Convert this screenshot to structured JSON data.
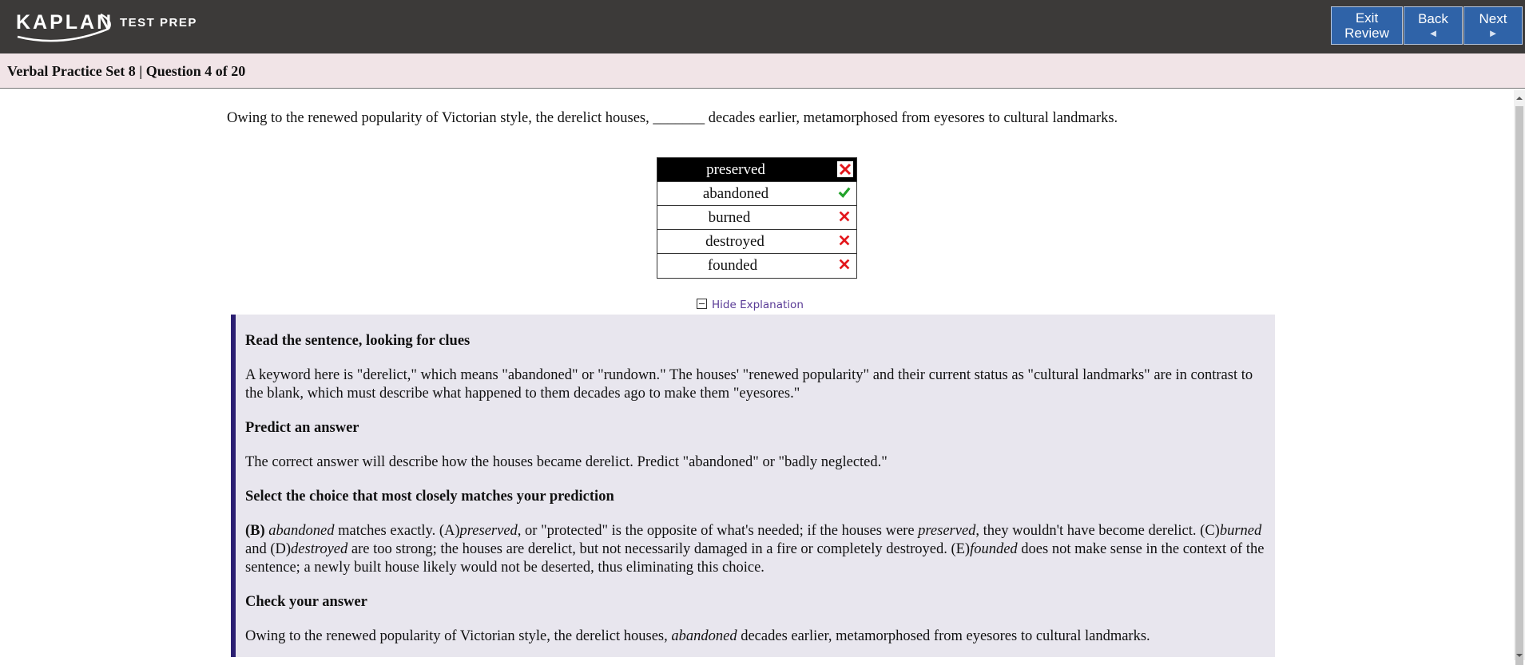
{
  "brand": {
    "name": "KAPLAN",
    "sub": "TEST PREP"
  },
  "nav": {
    "exit_line1": "Exit",
    "exit_line2": "Review",
    "back_label": "Back",
    "next_label": "Next"
  },
  "header": {
    "title": "Verbal Practice Set 8 | Question 4 of 20"
  },
  "question": {
    "text": "Owing to the renewed popularity of Victorian style, the derelict houses, _______ decades earlier, metamorphosed from eyesores to cultural landmarks."
  },
  "choices": [
    {
      "label": "preserved",
      "status": "incorrect",
      "selected": true
    },
    {
      "label": "abandoned",
      "status": "correct",
      "selected": false
    },
    {
      "label": "burned",
      "status": "incorrect",
      "selected": false
    },
    {
      "label": "destroyed",
      "status": "incorrect",
      "selected": false
    },
    {
      "label": "founded",
      "status": "incorrect",
      "selected": false
    }
  ],
  "explanation": {
    "toggle_label": "Hide Explanation",
    "h1": "Read the sentence, looking for clues",
    "p1": "A keyword here is \"derelict,\" which means \"abandoned\" or \"rundown.\" The houses' \"renewed popularity\" and their current status as \"cultural landmarks\" are in contrast to the blank, which must describe what happened to them decades ago to make them \"eyesores.\"",
    "h2": "Predict an answer",
    "p2": "The correct answer will describe how the houses became derelict. Predict \"abandoned\" or \"badly neglected.\"",
    "h3": "Select the choice that most closely matches your prediction",
    "p3": {
      "b": "(B)",
      "i1": "abandoned",
      "t1": " matches exactly. (A)",
      "i2": "preserved",
      "t2": ", or \"protected\" is the opposite of what's needed; if the houses were ",
      "i3": "preserved",
      "t3": ", they wouldn't have become derelict. (C)",
      "i4": "burned",
      "t4": " and (D)",
      "i5": "destroyed",
      "t5": " are too strong; the houses are derelict, but not necessarily damaged in a fire or completely destroyed. (E)",
      "i6": "founded",
      "t6": " does not make sense in the context of the sentence; a newly built house likely would not be deserted, thus eliminating this choice."
    },
    "h4": "Check your answer",
    "p4": {
      "t1": "Owing to the renewed popularity of Victorian style, the derelict houses, ",
      "i1": "abandoned",
      "t2": " decades earlier, metamorphosed from eyesores to cultural landmarks."
    }
  },
  "colors": {
    "topbar": "#3c3a39",
    "nav_button": "#2f63a8",
    "title_bar": "#f1e4e7",
    "explain_bg": "#e8e6ee",
    "explain_border": "#2b1f72",
    "correct": "#22a32b",
    "incorrect": "#e3161b",
    "link": "#5a3b96"
  }
}
